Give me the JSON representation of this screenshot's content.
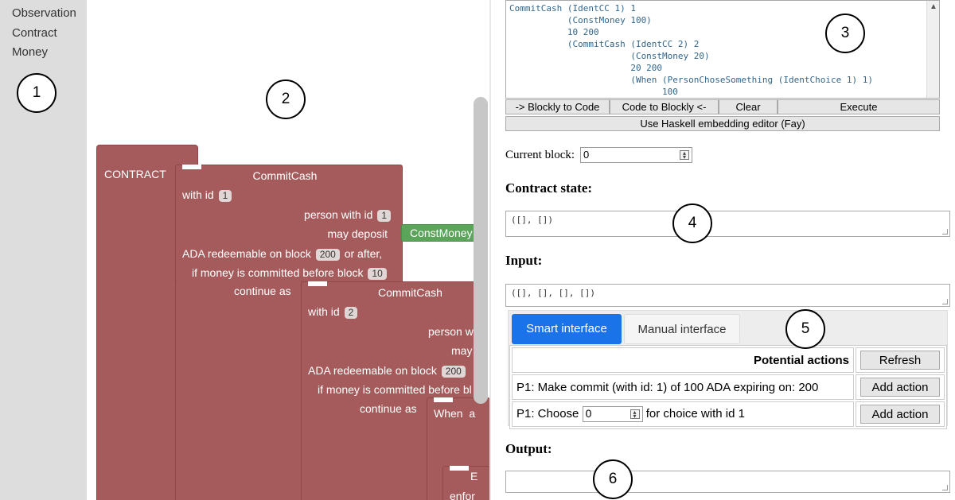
{
  "toolbox": {
    "items": [
      "Observation",
      "Contract",
      "Money"
    ]
  },
  "workspace": {
    "contract_label": "CONTRACT",
    "commit1": {
      "title": "CommitCash",
      "with_id": "with id",
      "id_value": "1",
      "person_with_id": "person with id",
      "person_value": "1",
      "may_deposit": "may deposit",
      "const_money": "ConstMoney",
      "ada_redeemable": "ADA redeemable on block",
      "redeem_block": "200",
      "or_after": "or after,",
      "if_committed": "if money is committed before block",
      "commit_block": "10",
      "continue_as": "continue as"
    },
    "commit2": {
      "title": "CommitCash",
      "with_id": "with id",
      "id_value": "2",
      "person_with": "person w",
      "may": "may",
      "ada_redeemable": "ADA redeemable on block",
      "redeem_block": "200",
      "if_committed": "if money is committed before bl",
      "continue_as": "continue as"
    },
    "when_block": {
      "label": "When",
      "suffix": "a"
    },
    "nested_block": {
      "line1": "E",
      "line2": "enfor"
    }
  },
  "code_editor": {
    "code": "CommitCash (IdentCC 1) 1\n           (ConstMoney 100)\n           10 200\n           (CommitCash (IdentCC 2) 2\n                       (ConstMoney 20)\n                       20 200\n                       (When (PersonChoseSomething (IdentChoice 1) 1)\n                             100",
    "scroll_arrow": "▲"
  },
  "buttons": {
    "blockly_to_code": "-> Blockly to Code",
    "code_to_blockly": "Code to Blockly <-",
    "clear": "Clear",
    "execute": "Execute",
    "haskell_editor": "Use Haskell embedding editor (Fay)"
  },
  "current_block": {
    "label": "Current block:",
    "value": "0"
  },
  "contract_state": {
    "heading": "Contract state:",
    "value": "([], [])"
  },
  "input": {
    "heading": "Input:",
    "value": "([], [], [], [])"
  },
  "tabs": {
    "smart": "Smart interface",
    "manual": "Manual interface"
  },
  "actions": {
    "header": "Potential actions",
    "refresh": "Refresh",
    "rows": [
      {
        "text": "P1: Make commit (with id: 1) of 100 ADA expiring on: 200",
        "button": "Add action"
      },
      {
        "prefix": "P1: Choose",
        "input_value": "0",
        "suffix": "for choice with id 1",
        "button": "Add action"
      }
    ]
  },
  "output": {
    "heading": "Output:",
    "value": ""
  },
  "annotations": [
    "1",
    "2",
    "3",
    "4",
    "5",
    "6"
  ]
}
